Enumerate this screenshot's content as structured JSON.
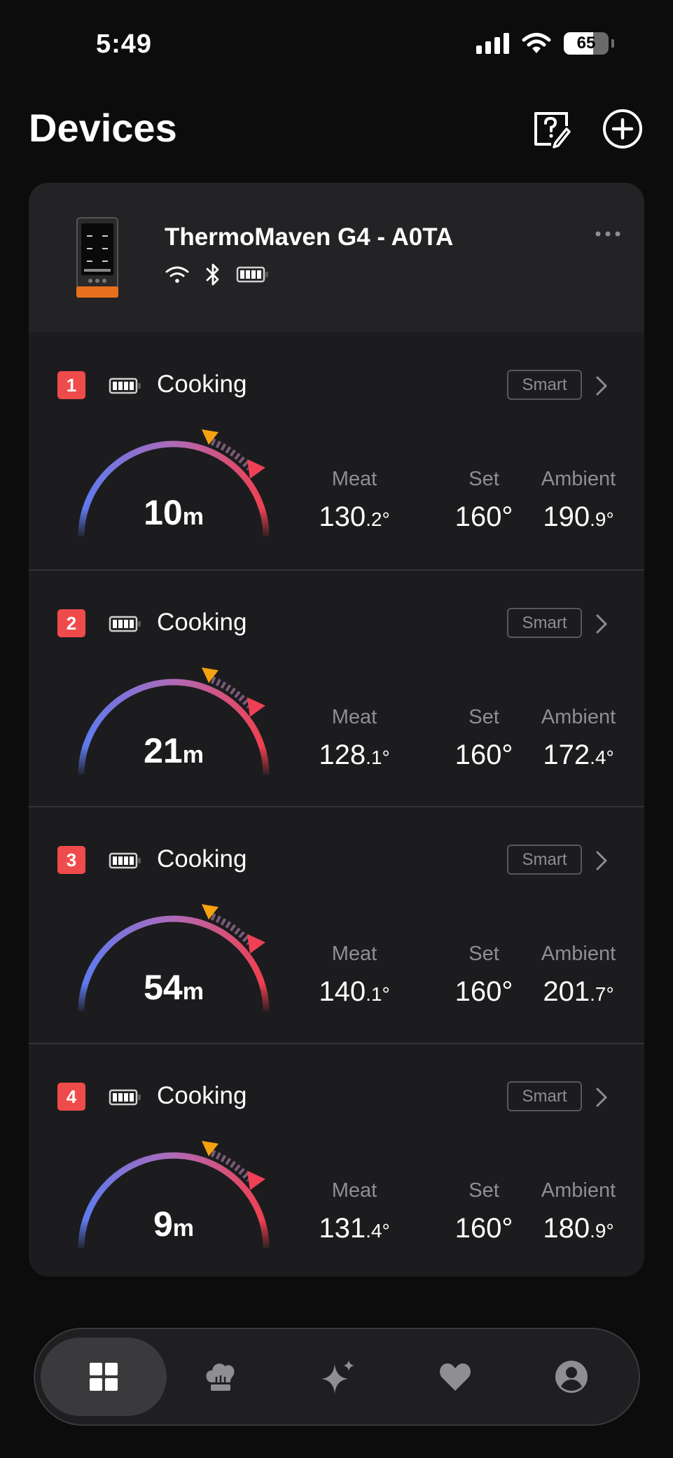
{
  "status_bar": {
    "time": "5:49",
    "battery_percent": "65",
    "battery_level": 0.65
  },
  "header": {
    "title": "Devices",
    "help_icon": "help-edit-icon",
    "add_icon": "plus-circle-icon"
  },
  "device": {
    "name": "ThermoMaven G4 - A0TA",
    "wifi_icon": "wifi-icon",
    "bluetooth_icon": "bluetooth-icon",
    "battery_icon": "battery-icon",
    "more_icon": "more-icon",
    "probes": [
      {
        "number": "1",
        "status": "Cooking",
        "badge": "Smart",
        "time_value": "10",
        "time_unit": "m",
        "meat_label": "Meat",
        "meat_int": "130",
        "meat_dec": ".2°",
        "set_label": "Set",
        "set_value": "160°",
        "ambient_label": "Ambient",
        "ambient_int": "190",
        "ambient_dec": ".9°"
      },
      {
        "number": "2",
        "status": "Cooking",
        "badge": "Smart",
        "time_value": "21",
        "time_unit": "m",
        "meat_label": "Meat",
        "meat_int": "128",
        "meat_dec": ".1°",
        "set_label": "Set",
        "set_value": "160°",
        "ambient_label": "Ambient",
        "ambient_int": "172",
        "ambient_dec": ".4°"
      },
      {
        "number": "3",
        "status": "Cooking",
        "badge": "Smart",
        "time_value": "54",
        "time_unit": "m",
        "meat_label": "Meat",
        "meat_int": "140",
        "meat_dec": ".1°",
        "set_label": "Set",
        "set_value": "160°",
        "ambient_label": "Ambient",
        "ambient_int": "201",
        "ambient_dec": ".7°"
      },
      {
        "number": "4",
        "status": "Cooking",
        "badge": "Smart",
        "time_value": "9",
        "time_unit": "m",
        "meat_label": "Meat",
        "meat_int": "131",
        "meat_dec": ".4°",
        "set_label": "Set",
        "set_value": "160°",
        "ambient_label": "Ambient",
        "ambient_int": "180",
        "ambient_dec": ".9°"
      }
    ]
  },
  "tab_bar": {
    "tabs": [
      {
        "icon": "grid-icon",
        "active": true
      },
      {
        "icon": "chef-hat-icon",
        "active": false
      },
      {
        "icon": "sparkle-icon",
        "active": false
      },
      {
        "icon": "heart-icon",
        "active": false
      },
      {
        "icon": "profile-icon",
        "active": false
      }
    ]
  },
  "colors": {
    "background": "#0c0c0d",
    "card": "#1c1c1e",
    "probe_badge": "#f04b4b",
    "gauge_start": "#5b7bf0",
    "gauge_end": "#f0404e",
    "current_marker": "#f5a20e",
    "target_marker": "#ef4055"
  }
}
